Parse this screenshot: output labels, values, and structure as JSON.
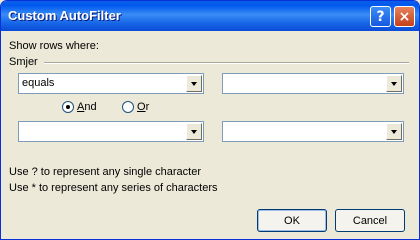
{
  "window": {
    "title": "Custom AutoFilter",
    "help_glyph": "?",
    "close_glyph": "×"
  },
  "dialog": {
    "show_rows_label": "Show rows where:",
    "field_name": "Smjer",
    "condition1": {
      "operator": "equals",
      "value": ""
    },
    "logic": {
      "and_label": "And",
      "or_label": "Or",
      "selected": "And"
    },
    "condition2": {
      "operator": "",
      "value": ""
    },
    "hint1": "Use ? to represent any single character",
    "hint2": "Use * to represent any series of characters"
  },
  "buttons": {
    "ok": "OK",
    "cancel": "Cancel"
  },
  "icons": {
    "help": "question-icon",
    "close": "close-icon",
    "dropdown": "chevron-down-icon"
  }
}
